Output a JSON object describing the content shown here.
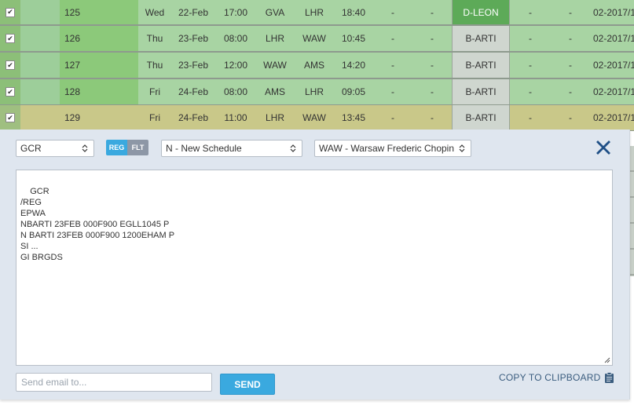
{
  "rows": [
    {
      "no": "125",
      "day": "Wed",
      "date": "22-Feb",
      "dep_time": "17:00",
      "dep": "GVA",
      "arr": "LHR",
      "arr_time": "18:40",
      "d1": "-",
      "d2": "-",
      "reg": "D-LEON",
      "d3": "-",
      "d4": "-",
      "until": "02-2017/1",
      "style": "green",
      "reg_style": "dark"
    },
    {
      "no": "126",
      "day": "Thu",
      "date": "23-Feb",
      "dep_time": "08:00",
      "dep": "LHR",
      "arr": "WAW",
      "arr_time": "10:45",
      "d1": "-",
      "d2": "-",
      "reg": "B-ARTI",
      "d3": "-",
      "d4": "-",
      "until": "02-2017/1",
      "style": "green",
      "reg_style": "light"
    },
    {
      "no": "127",
      "day": "Thu",
      "date": "23-Feb",
      "dep_time": "12:00",
      "dep": "WAW",
      "arr": "AMS",
      "arr_time": "14:20",
      "d1": "-",
      "d2": "-",
      "reg": "B-ARTI",
      "d3": "-",
      "d4": "-",
      "until": "02-2017/1",
      "style": "green",
      "reg_style": "light"
    },
    {
      "no": "128",
      "day": "Fri",
      "date": "24-Feb",
      "dep_time": "08:00",
      "dep": "AMS",
      "arr": "LHR",
      "arr_time": "09:05",
      "d1": "-",
      "d2": "-",
      "reg": "B-ARTI",
      "d3": "-",
      "d4": "-",
      "until": "02-2017/1",
      "style": "green",
      "reg_style": "light"
    },
    {
      "no": "129",
      "day": "Fri",
      "date": "24-Feb",
      "dep_time": "11:00",
      "dep": "LHR",
      "arr": "WAW",
      "arr_time": "13:45",
      "d1": "-",
      "d2": "-",
      "reg": "B-ARTI",
      "d3": "-",
      "d4": "-",
      "until": "02-2017/1",
      "style": "yellow",
      "reg_style": "light"
    }
  ],
  "panel": {
    "message_type": "GCR",
    "toggle": {
      "reg": "REG",
      "flt": "FLT"
    },
    "schedule_type": "N - New Schedule",
    "airport": "WAW - Warsaw Frederic Chopin",
    "message_text": "GCR\n/REG\nEPWA\nNBARTI 23FEB 000F900 EGLL1045 P\nN BARTI 23FEB 000F900 1200EHAM P\nSI ...\nGI BRGDS",
    "email_placeholder": "Send email to...",
    "send_label": "SEND",
    "copy_label": "COPY TO CLIPBOARD"
  },
  "colors": {
    "accent": "#3aa9df",
    "row_green": "#a8d4a3",
    "row_yellow": "#c9c889",
    "reg_dark": "#5daa58",
    "panel_bg": "#dfe6ef"
  },
  "icons": {
    "checkbox": "check-icon",
    "close": "close-icon",
    "select": "chevron-updown-icon",
    "copy": "clipboard-icon"
  }
}
